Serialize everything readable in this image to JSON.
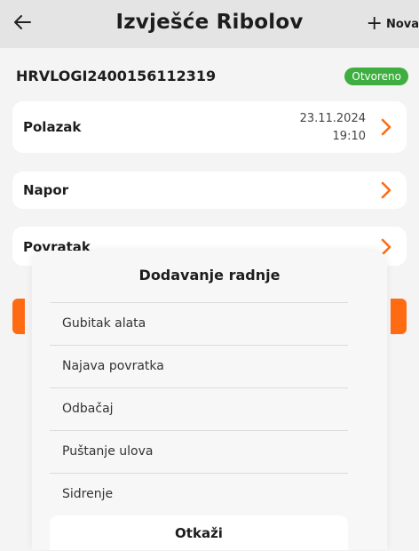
{
  "header": {
    "title": "Izvješće Ribolov",
    "new_label": "Nova",
    "back_icon": "arrow-left-icon"
  },
  "report": {
    "id": "HRVLOGI2400156112319",
    "status": "Otvoreno",
    "status_color": "#3fae41"
  },
  "sections": {
    "departure": {
      "label": "Polazak",
      "date": "23.11.2024",
      "time": "19:10"
    },
    "effort": {
      "label": "Napor"
    },
    "return": {
      "label": "Povratak"
    }
  },
  "accent_color": "#ff6b13",
  "action_sheet": {
    "title": "Dodavanje radnje",
    "items": [
      "Gubitak alata",
      "Najava povratka",
      "Odbačaj",
      "Puštanje ulova",
      "Sidrenje"
    ],
    "cancel_label": "Otkaži"
  }
}
